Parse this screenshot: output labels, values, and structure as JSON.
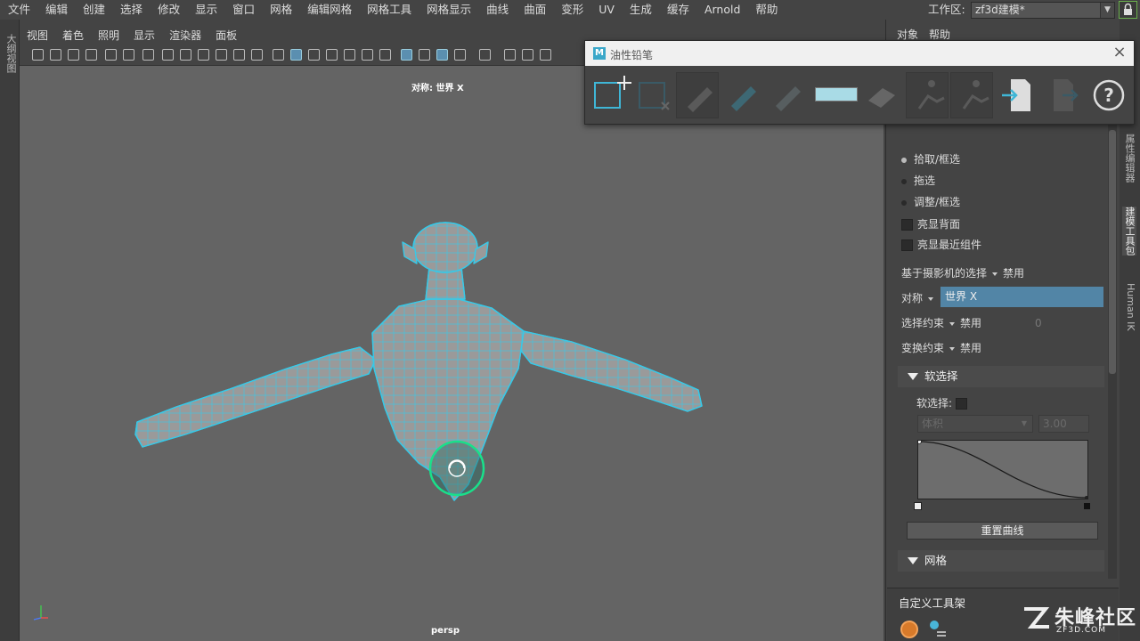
{
  "menubar": {
    "items": [
      "文件",
      "编辑",
      "创建",
      "选择",
      "修改",
      "显示",
      "窗口",
      "网格",
      "编辑网格",
      "网格工具",
      "网格显示",
      "曲线",
      "曲面",
      "变形",
      "UV",
      "生成",
      "缓存",
      "Arnold",
      "帮助"
    ],
    "workspace_label": "工作区:",
    "workspace_value": "zf3d建模*"
  },
  "left_strip": {
    "label": "大纲视图"
  },
  "viewport": {
    "menu": [
      "视图",
      "着色",
      "照明",
      "显示",
      "渲染器",
      "面板"
    ],
    "hud_symmetry": "对称: 世界 X",
    "camera_name": "persp",
    "axis_labels": [
      "Y",
      "Z",
      "X"
    ],
    "wire_color": "#37c9e8",
    "mesh_color": "#9a9a9a",
    "manip_color": "#19e08a"
  },
  "grease_pencil": {
    "title": "油性铅笔",
    "logo": "M",
    "tools": [
      "add-frame",
      "delete-frame",
      "pencil",
      "marker",
      "soft-pencil",
      "color-swatch",
      "eraser",
      "ghost-previous",
      "ghost-next",
      "import",
      "export",
      "help"
    ],
    "swatch_color": "#a9dbe6"
  },
  "right_panel": {
    "menu": [
      "对象",
      "帮助"
    ],
    "selection": {
      "pick_marquee": "拾取/框选",
      "drag": "拖选",
      "tweak_marquee": "调整/框选",
      "highlight_backfaces": "亮显背面",
      "highlight_nearest": "亮显最近组件"
    },
    "camera_based_label": "基于摄影机的选择",
    "camera_based_value": "禁用",
    "symmetry_label": "对称",
    "symmetry_value": "世界 X",
    "select_constraint_label": "选择约束",
    "select_constraint_value": "禁用",
    "select_constraint_number": "0",
    "transform_constraint_label": "变换约束",
    "transform_constraint_value": "禁用",
    "soft_select_header": "软选择",
    "soft_select_label": "软选择:",
    "falloff_mode": "体积",
    "falloff_radius": "3.00",
    "reset_curve": "重置曲线",
    "mesh_header": "网格",
    "shelf_label": "自定义工具架"
  },
  "vertical_tabs": [
    "属性编辑器",
    "建模工具包",
    "Human IK"
  ],
  "watermark": {
    "big": "朱峰社区",
    "small": "ZF3D.COM"
  }
}
